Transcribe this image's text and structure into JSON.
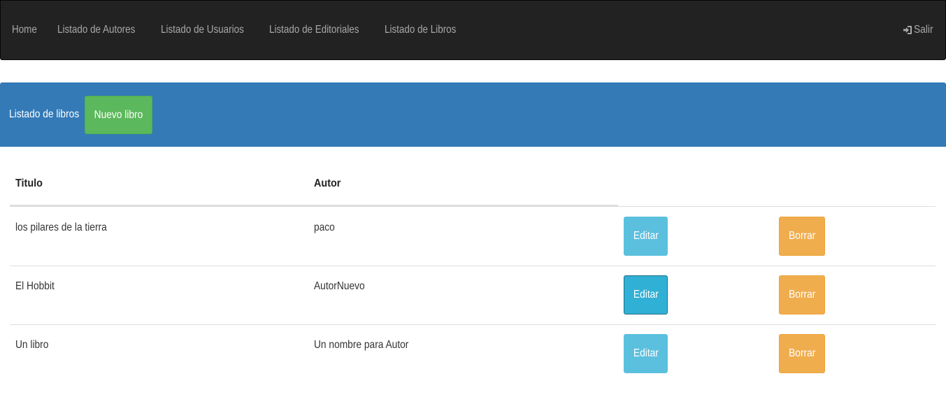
{
  "navbar": {
    "links": [
      "Home",
      "Listado de Autores",
      "Listado de Usuarios",
      "Listado de Editoriales",
      "Listado de Libros"
    ],
    "logout_label": "Salir"
  },
  "panel": {
    "title": "Listado de libros",
    "new_button_label": "Nuevo libro"
  },
  "table": {
    "headers": [
      "Titulo",
      "Autor"
    ],
    "rows": [
      {
        "titulo": "los pilares de la tierra",
        "autor": "paco",
        "edit_label": "Editar",
        "delete_label": "Borrar"
      },
      {
        "titulo": "El Hobbit",
        "autor": "AutorNuevo",
        "edit_label": "Editar",
        "delete_label": "Borrar"
      },
      {
        "titulo": "Un libro",
        "autor": "Un nombre para Autor",
        "edit_label": "Editar",
        "delete_label": "Borrar"
      }
    ]
  },
  "colors": {
    "navbar_bg": "#222222",
    "panel_primary": "#337ab7",
    "success": "#5cb85c",
    "info": "#5bc0de",
    "warning": "#f0ad4e"
  }
}
